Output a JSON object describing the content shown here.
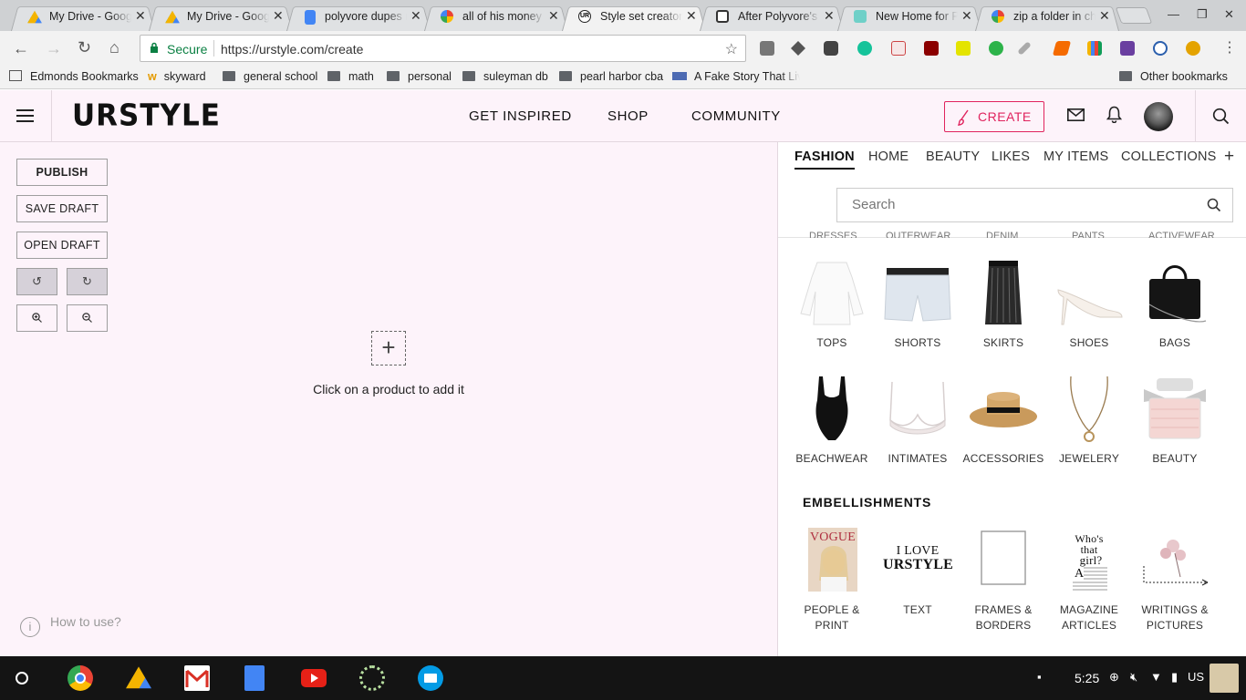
{
  "browser": {
    "tabs": [
      {
        "title": "My Drive - Google Drive",
        "icon": "google-drive-icon"
      },
      {
        "title": "My Drive - Google Drive",
        "icon": "google-drive-icon"
      },
      {
        "title": "polyvore dupes reddit",
        "icon": "google-docs-icon"
      },
      {
        "title": "all of his money",
        "icon": "google-icon"
      },
      {
        "title": "Style set creator",
        "icon": "urstyle-icon"
      },
      {
        "title": "After Polyvore's Demise",
        "icon": "page-icon"
      },
      {
        "title": "New Home for Polyvore",
        "icon": "page-icon"
      },
      {
        "title": "zip a folder in chromebook",
        "icon": "google-icon"
      }
    ],
    "secure_label": "Secure",
    "url": "https://urstyle.com/create",
    "bookmarks": [
      "Edmonds Bookmarks",
      "skyward",
      "general school",
      "math",
      "personal",
      "suleyman db",
      "pearl harbor cba",
      "A Fake Story That Liv"
    ],
    "other_bookmarks": "Other bookmarks"
  },
  "header": {
    "logo": "URSTYLE",
    "nav": [
      "GET INSPIRED",
      "SHOP",
      "COMMUNITY"
    ],
    "create": "CREATE"
  },
  "tools": {
    "publish": "PUBLISH",
    "save_draft": "SAVE DRAFT",
    "open_draft": "OPEN DRAFT"
  },
  "canvas": {
    "plus": "+",
    "hint": "Click on a product to add it",
    "how_to": "How to use?"
  },
  "panel": {
    "tabs": [
      "FASHION",
      "HOME",
      "BEAUTY",
      "LIKES",
      "MY ITEMS",
      "COLLECTIONS"
    ],
    "add_tab": "+",
    "search_placeholder": "Search",
    "cut_labels": [
      "DRESSES",
      "OUTERWEAR",
      "DENIM",
      "PANTS",
      "ACTIVEWEAR"
    ],
    "row1": [
      "TOPS",
      "SHORTS",
      "SKIRTS",
      "SHOES",
      "BAGS"
    ],
    "row2": [
      "BEACHWEAR",
      "INTIMATES",
      "ACCESSORIES",
      "JEWELERY",
      "BEAUTY"
    ],
    "embellishments_title": "EMBELLISHMENTS",
    "row3": [
      "PEOPLE & PRINT",
      "TEXT",
      "FRAMES & BORDERS",
      "MAGAZINE ARTICLES",
      "WRITINGS & PICTURES"
    ],
    "text_sample_line1": "I LOVE",
    "text_sample_line2": "URSTYLE"
  },
  "shelf": {
    "time": "5:25",
    "locale": "US"
  },
  "colors": {
    "accent": "#e0245e",
    "page_bg": "#fdf3fa",
    "secure": "#0b8043"
  }
}
